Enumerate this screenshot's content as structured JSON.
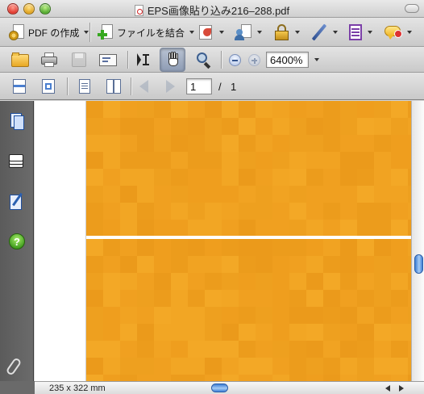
{
  "window": {
    "title": "EPS画像貼り込み216–288.pdf"
  },
  "toolbar1": {
    "create_pdf_label": "PDF の作成",
    "combine_label": "ファイルを結合"
  },
  "toolbar2": {
    "zoom_value": "6400%"
  },
  "toolbar3": {
    "current_page": "1",
    "page_separator": "/",
    "total_pages": "1"
  },
  "statusbar": {
    "page_size": "235 x 322 mm"
  },
  "colors": {
    "page_fill": "#f0a020",
    "accent_blue": "#3e7fd6",
    "nav_panel": "#5b5b5b"
  },
  "icons": {
    "toolbar1": [
      "gear-doc-icon",
      "combine-icon",
      "export-icon",
      "user-icon",
      "lock-icon",
      "pen-icon",
      "form-icon",
      "comment-icon"
    ],
    "toolbar2": [
      "folder-icon",
      "print-icon",
      "save-icon",
      "email-icon",
      "select-tool-icon",
      "hand-tool-icon",
      "zoom-tool-icon",
      "zoom-out-icon",
      "zoom-in-icon"
    ],
    "toolbar3": [
      "fit-width-icon",
      "fit-page-icon",
      "single-page-icon",
      "two-page-icon",
      "previous-page-icon",
      "next-page-icon"
    ],
    "nav_panel": [
      "pages-icon",
      "layers-icon",
      "signatures-icon",
      "help-icon",
      "attachments-icon"
    ]
  }
}
